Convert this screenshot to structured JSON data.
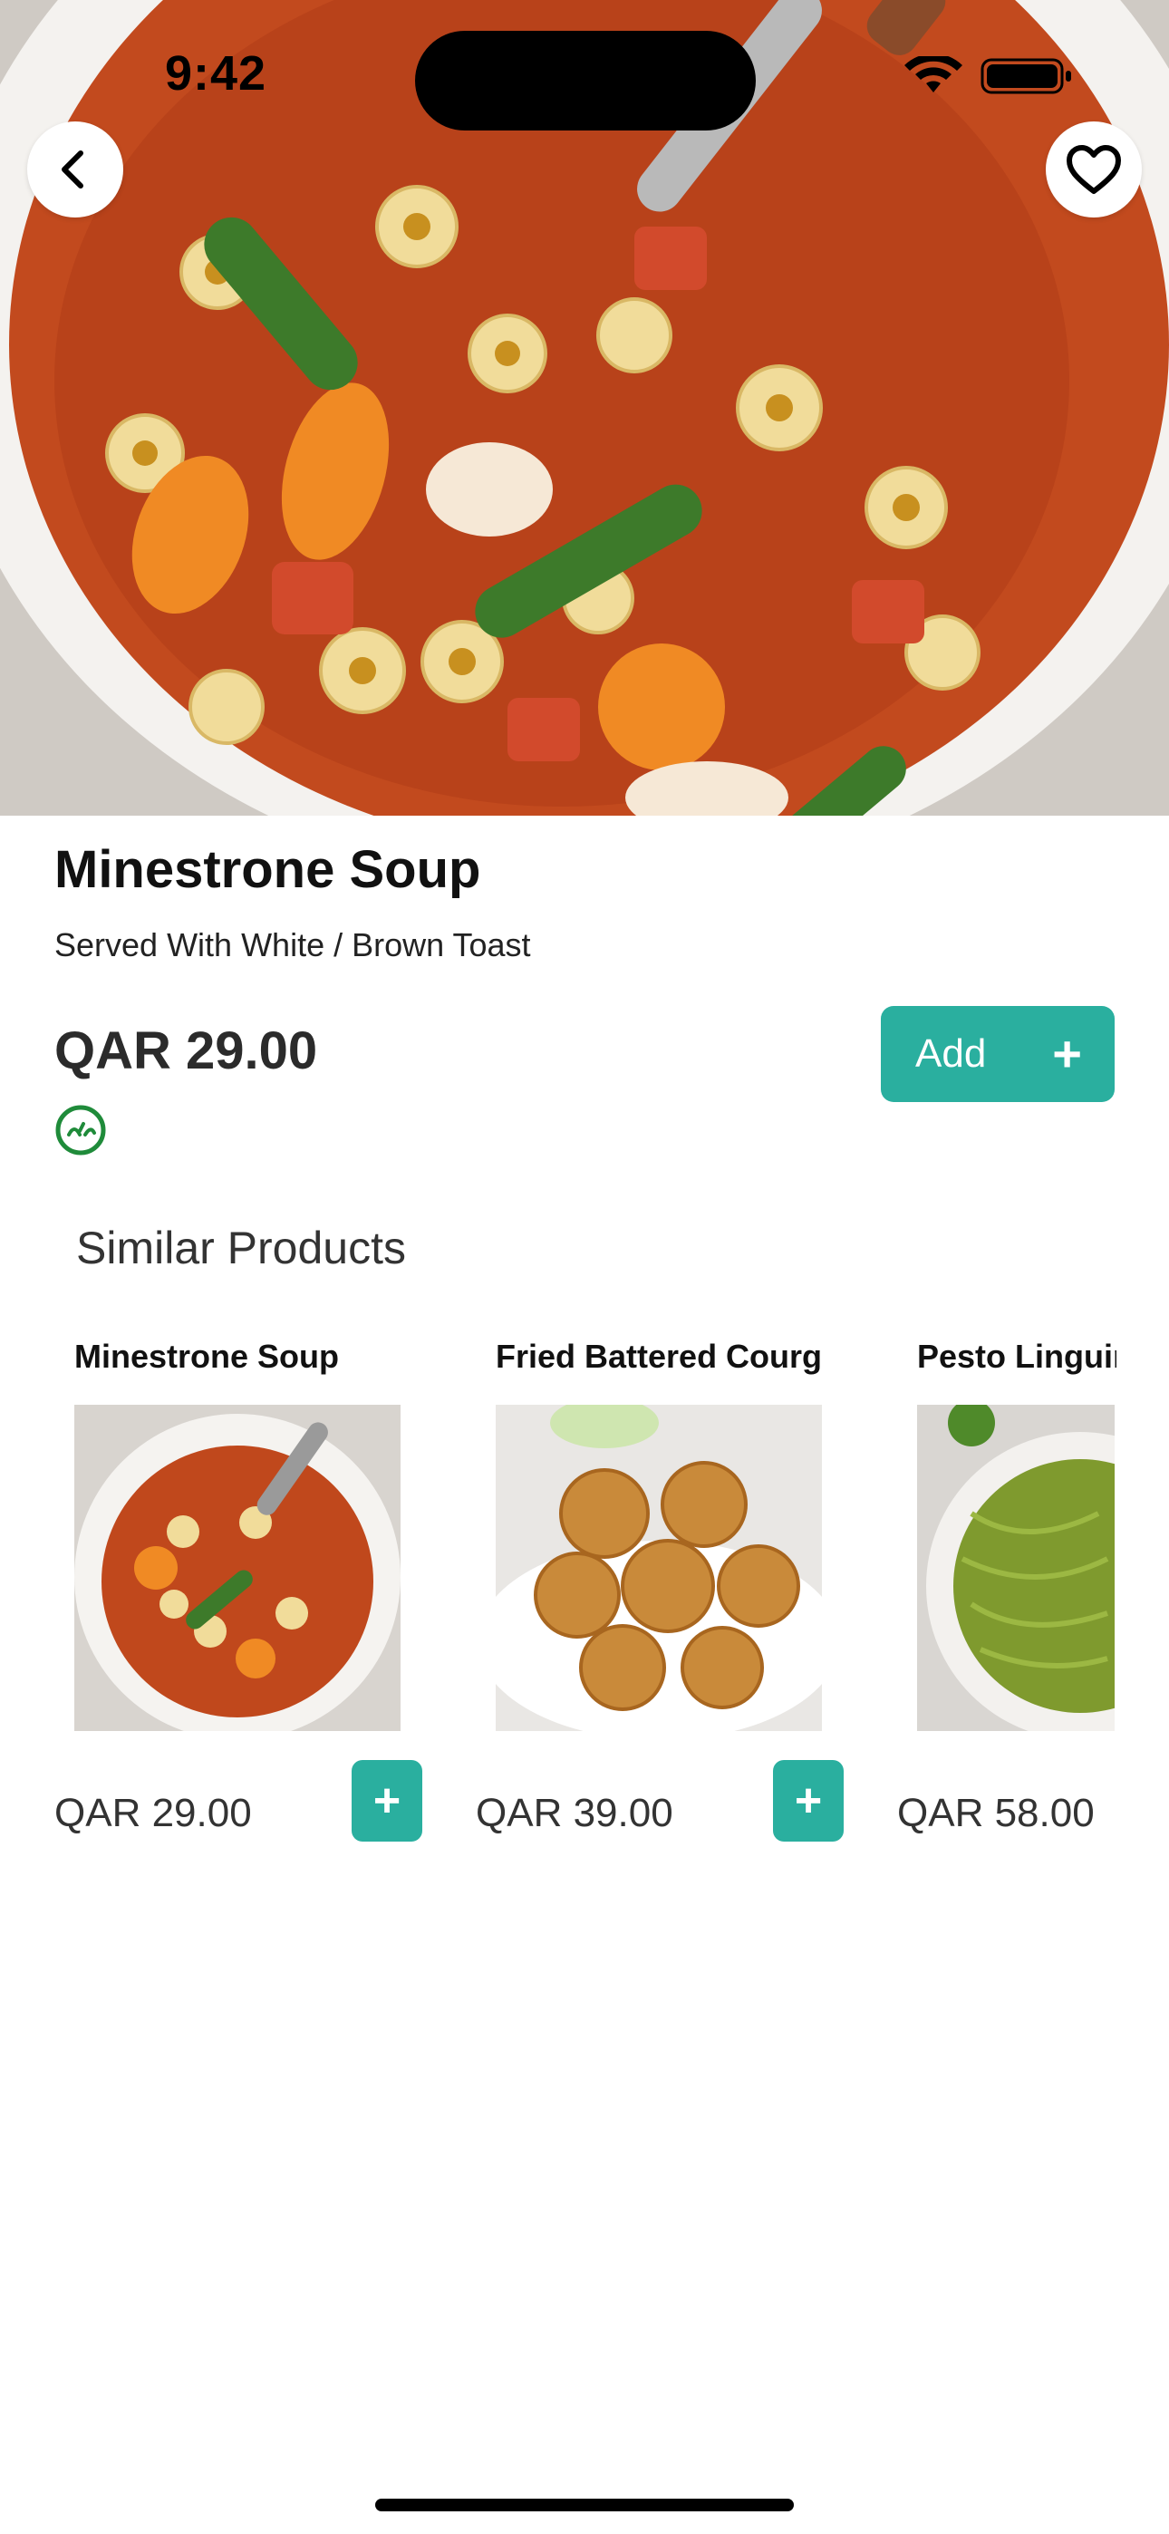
{
  "status_bar": {
    "time": "9:42",
    "icons": [
      "wifi-icon",
      "battery-icon"
    ]
  },
  "header": {
    "back_icon": "chevron-left-icon",
    "favorite_icon": "heart-outline-icon"
  },
  "product": {
    "name": "Minestrone Soup",
    "description": "Served With White / Brown Toast",
    "price": "QAR 29.00",
    "badge_icon": "halal-icon",
    "add_label": "Add",
    "add_icon": "plus-icon"
  },
  "similar": {
    "title": "Similar Products",
    "items": [
      {
        "name": "Minestrone Soup",
        "price": "QAR 29.00",
        "add_icon": "+"
      },
      {
        "name": "Fried Battered Courg",
        "price": "QAR 39.00",
        "add_icon": "+"
      },
      {
        "name": "Pesto Linguir",
        "price": "QAR 58.00",
        "add_icon": "+"
      }
    ]
  },
  "colors": {
    "accent": "#2aaf9f",
    "halal_green": "#1f8b3a",
    "text": "#111111"
  }
}
